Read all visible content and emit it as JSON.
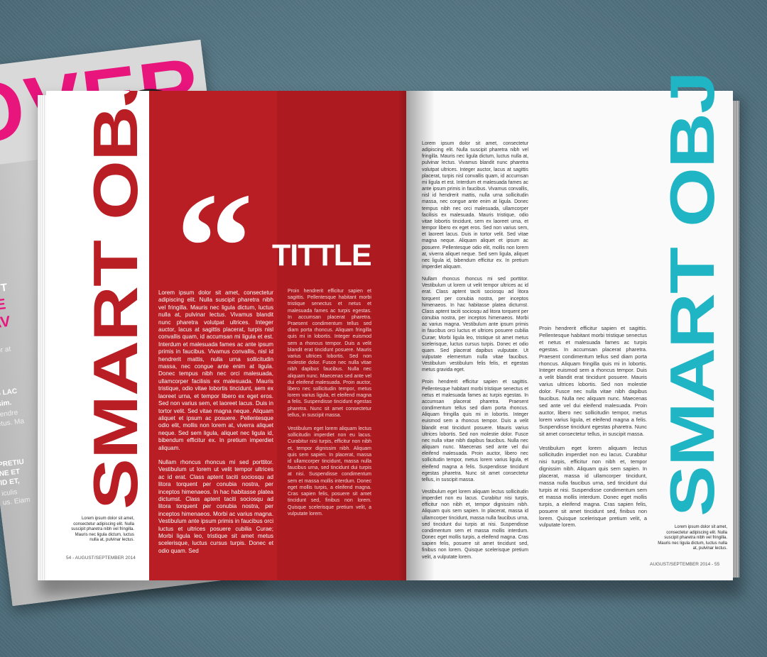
{
  "back_cover": {
    "headline": "OVER!",
    "side_lines": [
      "T",
      "GE",
      "SAV",
      "ertor at",
      "ssim.",
      "US LAC",
      "ISSIM.",
      "t hendre",
      "netus. Ma",
      "PRETIU",
      "NE ET",
      "ID ET,",
      "iculis",
      "us. Eiam"
    ]
  },
  "left_page": {
    "vertical_title": "SMART OBJ",
    "quote_mark": "“",
    "title": "TITTLE",
    "col1_p1": "Lorem ipsum dolor sit amet, consectetur adipiscing elit. Nulla suscipit pharetra nibh vel fringilla. Mauris nec ligula dictum, luctus nulla at, pulvinar lectus. Vivamus blandit nunc pharetra volutpat ultrices. Integer auctor, lacus at sagittis placerat, turpis nisl convallis quam, id accumsan mi ligula et est. Interdum et malesuada fames ac ante ipsum primis in faucibus. Vivamus convallis, nisl id hendrerit mattis, nulla urna sollicitudin massa, nec congue ante enim at ligula. Donec tempus nibh nec orci malesuada, ullamcorper facilisis ex malesuada. Mauris tristique, odio vitae lobortis tincidunt, sem ex laoreet urna, et tempor libero ex eget eros. Sed non varius sem, et laoreet lacus. Duis in tortor velit. Sed vitae magna neque. Aliquam aliquet et ipsum ac posuere. Pellentesque odio elit, mollis non lorem at, viverra aliquet neque. Sed sem ligula, aliquet nec ligula id, bibendum efficitur ex. In pretium imperdiet aliquam.",
    "col1_p2": "Nullam rhoncus rhoncus mi sed porttitor. Vestibulum ut lorem ut velit tempor ultrices ac id erat. Class aptent taciti sociosqu ad litora torquent per conubia nostra, per inceptos himenaeos. In hac habitasse platea dictumst. Class aptent taciti sociosqu ad litora torquent per conubia nostra, per inceptos himenaeos. Morbi ac varius magna. Vestibulum ante ipsum primis in faucibus orci luctus et ultrices posuere cubilia Curae; Morbi ligula leo, tristique sit amet metus scelerisque, luctus cursus turpis. Donec et odio quam. Sed",
    "col2_p1": "Proin hendrerit efficitur sapien et sagittis. Pellentesque habitant morbi tristique senectus et netus et malesuada fames ac turpis egestas. In accumsan placerat pharetra. Praesent condimentum tellus sed diam porta rhoncus. Aliquam fringilla quis mi in lobortis. Integer euismod sem a rhoncus tempor. Duis a velit blandit erat tincidunt posuere. Mauris varius ultrices lobortis. Sed non molestie dolor. Fusce nec nulla vitae nibh dapibus faucibus. Nulla nec aliquam nunc. Maecenas sed ante vel dui eleifend malesuada. Proin auctor, libero nec sollicitudin tempor, metus lorem varius ligula, et eleifend magna a felis. Suspendisse tincidunt egestas pharetra. Nunc sit amet consectetur tellus, in suscipit massa.",
    "col2_p2": "Vestibulum eget lorem aliquam lectus sollicitudin imperdiet non eu lacus. Curabitur nisi turpis, efficitur non nibh et, tempor dignissim nibh. Aliquam quis sem sapien. In placerat, massa id ullamcorper tincidunt, massa nulla faucibus urna, sed tincidunt dui turpis at nisi. Suspendisse condimentum sem et massa mollis interdum. Donec eget mollis turpis, a eleifend magna. Cras sapien felis, posuere sit amet tincidunt sed, finibus non lorem. Quisque scelerisque pretium velit, a vulputate lorem.",
    "caption": "Lorem ipsum dolor sit amet, consectetur adipiscing elit. Nulla suscipit pharetra nibh vel fringilla. Mauris nec ligula dictum, luctus nulla at, pulvinar lectus.",
    "folio": "54 - AUGUST/SEPTEMBER 2014"
  },
  "right_page": {
    "vertical_title": "SMART OBJ",
    "col1_p1": "Lorem ipsum dolor sit amet, consectetur adipiscing elit. Nulla suscipit pharetra nibh vel fringilla. Mauris nec ligula dictum, luctus nulla at, pulvinar lectus. Vivamus blandit nunc pharetra volutpat ultrices. Integer auctor, lacus at sagittis placerat, turpis nisl convallis quam, id accumsan mi ligula et est. Interdum et malesuada fames ac ante ipsum primis in faucibus. Vivamus convallis, nisl id hendrerit mattis, nulla urna sollicitudin massa, nec congue ante enim at ligula. Donec tempus nibh nec orci malesuada, ullamcorper facilisis ex malesuada. Mauris tristique, odio vitae lobortis tincidunt, sem ex laoreet urna, et tempor libero ex eget eros. Sed non varius sem, et laoreet lacus. Duis in tortor velit. Sed vitae magna neque. Aliquam aliquet et ipsum ac posuere. Pellentesque odio elit, mollis non lorem at, viverra aliquet neque. Sed sem ligula, aliquet nec ligula id, bibendum efficitur ex. In pretium imperdiet aliquam.",
    "col1_p2": "Nullam rhoncus rhoncus mi sed porttitor. Vestibulum ut lorem ut velit tempor ultrices ac id erat. Class aptent taciti sociosqu ad litora torquent per conubia nostra, per inceptos himenaeos. In hac habitasse platea dictumst. Class aptent taciti sociosqu ad litora torquent per conubia nostra, per inceptos himenaeos. Morbi ac varius magna. Vestibulum ante ipsum primis in faucibus orci luctus et ultrices posuere cubilia Curae; Morbi ligula leo, tristique sit amet metus scelerisque, luctus cursus turpis. Donec et odio quam. Sed placerat dapibus vulputate. Ut vulputate elementum nulla vitae faucibus. Vestibulum vestibulum felis felis, et egestas metus gravida eget.",
    "col1_p3": "Proin hendrerit efficitur sapien et sagittis. Pellentesque habitant morbi tristique senectus et netus et malesuada fames ac turpis egestas. In accumsan placerat pharetra. Praesent condimentum tellus sed diam porta rhoncus. Aliquam fringilla quis mi in lobortis. Integer euismod sem a rhoncus tempor. Duis a velit blandit erat tincidunt posuere. Mauris varius ultrices lobortis. Sed non molestie dolor. Fusce nec nulla vitae nibh dapibus faucibus. Nulla nec aliquam nunc. Maecenas sed ante vel dui eleifend malesuada. Proin auctor, libero nec sollicitudin tempor, metus lorem varius ligula, et eleifend magna a felis. Suspendisse tincidunt egestas pharetra. Nunc sit amet consectetur tellus, in suscipit massa.",
    "col1_p4": "Vestibulum eget lorem aliquam lectus sollicitudin imperdiet non eu lacus. Curabitur nisi turpis, efficitur non nibh et, tempor dignissim nibh. Aliquam quis sem sapien. In placerat, massa id ullamcorper tincidunt, massa nulla faucibus urna, sed tincidunt dui turpis at nisi. Suspendisse condimentum sem et massa mollis interdum. Donec eget mollis turpis, a eleifend magna. Cras sapien felis, posuere sit amet tincidunt sed, finibus non lorem. Quisque scelerisque pretium velit, a vulputate lorem.",
    "col2_p1": "Proin hendrerit efficitur sapien et sagittis. Pellentesque habitant morbi tristique senectus et netus et malesuada fames ac turpis egestas. In accumsan placerat pharetra. Praesent condimentum tellus sed diam porta rhoncus. Aliquam fringilla quis mi in lobortis. Integer euismod sem a rhoncus tempor. Duis a velit blandit erat tincidunt posuere. Mauris varius ultrices lobortis. Sed non molestie dolor. Fusce nec nulla vitae nibh dapibus faucibus. Nulla nec aliquam nunc. Maecenas sed ante vel dui eleifend malesuada. Proin auctor, libero nec sollicitudin tempor, metus lorem varius ligula, et eleifend magna a felis. Suspendisse tincidunt egestas pharetra. Nunc sit amet consectetur tellus, in suscipit massa.",
    "col2_p2": "Vestibulum eget lorem aliquam lectus sollicitudin imperdiet non eu lacus. Curabitur nisi turpis, efficitur non nibh et, tempor dignissim nibh. Aliquam quis sem sapien. In placerat, massa id ullamcorper tincidunt, massa nulla faucibus urna, sed tincidunt dui turpis at nisi. Suspendisse condimentum sem et massa mollis interdum. Donec eget mollis turpis, a eleifend magna. Cras sapien felis, posuere sit amet tincidunt sed, finibus non lorem. Quisque scelerisque pretium velit, a vulputate lorem.",
    "caption": "Lorem ipsum dolor sit amet, consectetur adipiscing elit. Nulla suscipit pharetra nibh vel fringilla. Mauris nec ligula dictum, luctus nulla at, pulvinar lectus.",
    "folio": "AUGUST/SEPTEMBER 2014 - 55"
  },
  "colors": {
    "red": "#b81e23",
    "teal": "#20b5c4",
    "pink": "#e8157d",
    "background": "#5a7a87"
  }
}
